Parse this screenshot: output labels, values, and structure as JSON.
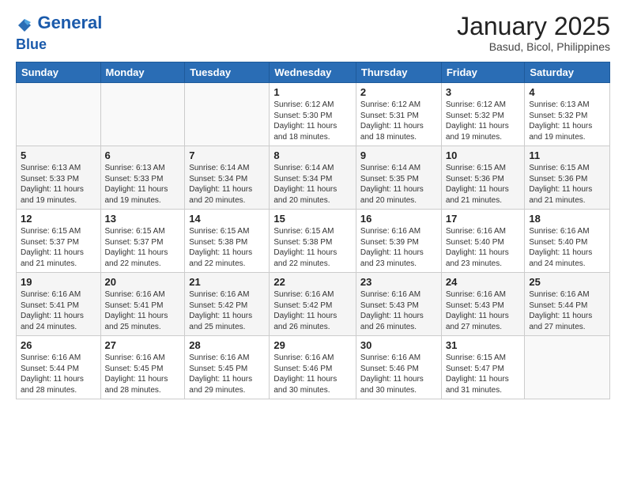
{
  "header": {
    "logo_line1": "General",
    "logo_line2": "Blue",
    "month": "January 2025",
    "location": "Basud, Bicol, Philippines"
  },
  "days_of_week": [
    "Sunday",
    "Monday",
    "Tuesday",
    "Wednesday",
    "Thursday",
    "Friday",
    "Saturday"
  ],
  "weeks": [
    [
      {
        "day": "",
        "info": ""
      },
      {
        "day": "",
        "info": ""
      },
      {
        "day": "",
        "info": ""
      },
      {
        "day": "1",
        "info": "Sunrise: 6:12 AM\nSunset: 5:30 PM\nDaylight: 11 hours\nand 18 minutes."
      },
      {
        "day": "2",
        "info": "Sunrise: 6:12 AM\nSunset: 5:31 PM\nDaylight: 11 hours\nand 18 minutes."
      },
      {
        "day": "3",
        "info": "Sunrise: 6:12 AM\nSunset: 5:32 PM\nDaylight: 11 hours\nand 19 minutes."
      },
      {
        "day": "4",
        "info": "Sunrise: 6:13 AM\nSunset: 5:32 PM\nDaylight: 11 hours\nand 19 minutes."
      }
    ],
    [
      {
        "day": "5",
        "info": "Sunrise: 6:13 AM\nSunset: 5:33 PM\nDaylight: 11 hours\nand 19 minutes."
      },
      {
        "day": "6",
        "info": "Sunrise: 6:13 AM\nSunset: 5:33 PM\nDaylight: 11 hours\nand 19 minutes."
      },
      {
        "day": "7",
        "info": "Sunrise: 6:14 AM\nSunset: 5:34 PM\nDaylight: 11 hours\nand 20 minutes."
      },
      {
        "day": "8",
        "info": "Sunrise: 6:14 AM\nSunset: 5:34 PM\nDaylight: 11 hours\nand 20 minutes."
      },
      {
        "day": "9",
        "info": "Sunrise: 6:14 AM\nSunset: 5:35 PM\nDaylight: 11 hours\nand 20 minutes."
      },
      {
        "day": "10",
        "info": "Sunrise: 6:15 AM\nSunset: 5:36 PM\nDaylight: 11 hours\nand 21 minutes."
      },
      {
        "day": "11",
        "info": "Sunrise: 6:15 AM\nSunset: 5:36 PM\nDaylight: 11 hours\nand 21 minutes."
      }
    ],
    [
      {
        "day": "12",
        "info": "Sunrise: 6:15 AM\nSunset: 5:37 PM\nDaylight: 11 hours\nand 21 minutes."
      },
      {
        "day": "13",
        "info": "Sunrise: 6:15 AM\nSunset: 5:37 PM\nDaylight: 11 hours\nand 22 minutes."
      },
      {
        "day": "14",
        "info": "Sunrise: 6:15 AM\nSunset: 5:38 PM\nDaylight: 11 hours\nand 22 minutes."
      },
      {
        "day": "15",
        "info": "Sunrise: 6:15 AM\nSunset: 5:38 PM\nDaylight: 11 hours\nand 22 minutes."
      },
      {
        "day": "16",
        "info": "Sunrise: 6:16 AM\nSunset: 5:39 PM\nDaylight: 11 hours\nand 23 minutes."
      },
      {
        "day": "17",
        "info": "Sunrise: 6:16 AM\nSunset: 5:40 PM\nDaylight: 11 hours\nand 23 minutes."
      },
      {
        "day": "18",
        "info": "Sunrise: 6:16 AM\nSunset: 5:40 PM\nDaylight: 11 hours\nand 24 minutes."
      }
    ],
    [
      {
        "day": "19",
        "info": "Sunrise: 6:16 AM\nSunset: 5:41 PM\nDaylight: 11 hours\nand 24 minutes."
      },
      {
        "day": "20",
        "info": "Sunrise: 6:16 AM\nSunset: 5:41 PM\nDaylight: 11 hours\nand 25 minutes."
      },
      {
        "day": "21",
        "info": "Sunrise: 6:16 AM\nSunset: 5:42 PM\nDaylight: 11 hours\nand 25 minutes."
      },
      {
        "day": "22",
        "info": "Sunrise: 6:16 AM\nSunset: 5:42 PM\nDaylight: 11 hours\nand 26 minutes."
      },
      {
        "day": "23",
        "info": "Sunrise: 6:16 AM\nSunset: 5:43 PM\nDaylight: 11 hours\nand 26 minutes."
      },
      {
        "day": "24",
        "info": "Sunrise: 6:16 AM\nSunset: 5:43 PM\nDaylight: 11 hours\nand 27 minutes."
      },
      {
        "day": "25",
        "info": "Sunrise: 6:16 AM\nSunset: 5:44 PM\nDaylight: 11 hours\nand 27 minutes."
      }
    ],
    [
      {
        "day": "26",
        "info": "Sunrise: 6:16 AM\nSunset: 5:44 PM\nDaylight: 11 hours\nand 28 minutes."
      },
      {
        "day": "27",
        "info": "Sunrise: 6:16 AM\nSunset: 5:45 PM\nDaylight: 11 hours\nand 28 minutes."
      },
      {
        "day": "28",
        "info": "Sunrise: 6:16 AM\nSunset: 5:45 PM\nDaylight: 11 hours\nand 29 minutes."
      },
      {
        "day": "29",
        "info": "Sunrise: 6:16 AM\nSunset: 5:46 PM\nDaylight: 11 hours\nand 30 minutes."
      },
      {
        "day": "30",
        "info": "Sunrise: 6:16 AM\nSunset: 5:46 PM\nDaylight: 11 hours\nand 30 minutes."
      },
      {
        "day": "31",
        "info": "Sunrise: 6:15 AM\nSunset: 5:47 PM\nDaylight: 11 hours\nand 31 minutes."
      },
      {
        "day": "",
        "info": ""
      }
    ]
  ]
}
